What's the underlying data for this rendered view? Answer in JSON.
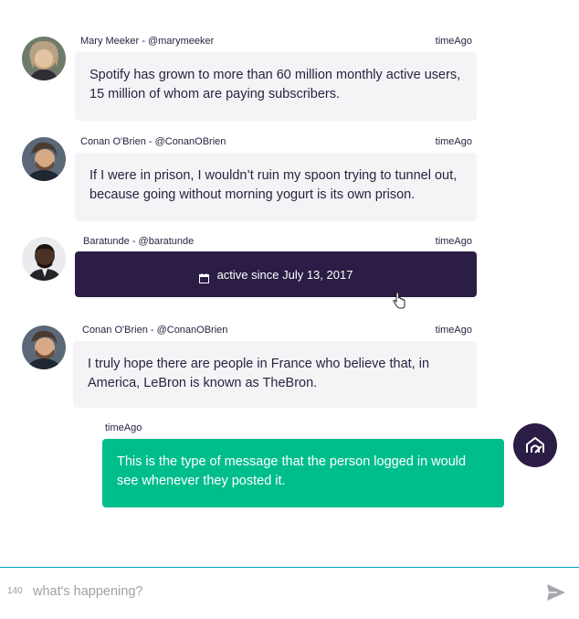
{
  "messages": [
    {
      "author": "Mary Meeker - @marymeeker",
      "time": "timeAgo",
      "text": "Spotify has grown to more than 60 million monthly active users, 15 million of whom are paying subscribers."
    },
    {
      "author": "Conan O'Brien - @ConanOBrien",
      "time": "timeAgo",
      "text": "If I were in prison, I wouldn’t ruin my spoon trying to tunnel out, because going without morning yogurt is its own prison."
    },
    {
      "author": "Baratunde - @baratunde",
      "time": "timeAgo",
      "text": "active since July 13, 2017",
      "icon": "calendar-icon"
    },
    {
      "author": "Conan O'Brien - @ConanOBrien",
      "time": "timeAgo",
      "text": "I truly hope there are people in France who believe that, in America, LeBron is known as TheBron."
    }
  ],
  "self_message": {
    "time": "timeAgo",
    "text": "This is the type of message that the person logged in would see whenever they posted it.",
    "avatar_icon": "home-logo-icon"
  },
  "composer": {
    "counter": "140",
    "placeholder": "what's happening?",
    "send_icon": "send-icon"
  },
  "colors": {
    "bubble_bg": "#f4f4f6",
    "dark_bubble_bg": "#2b1d45",
    "self_bubble_bg": "#00bd8c",
    "composer_border": "#00a0c0"
  }
}
